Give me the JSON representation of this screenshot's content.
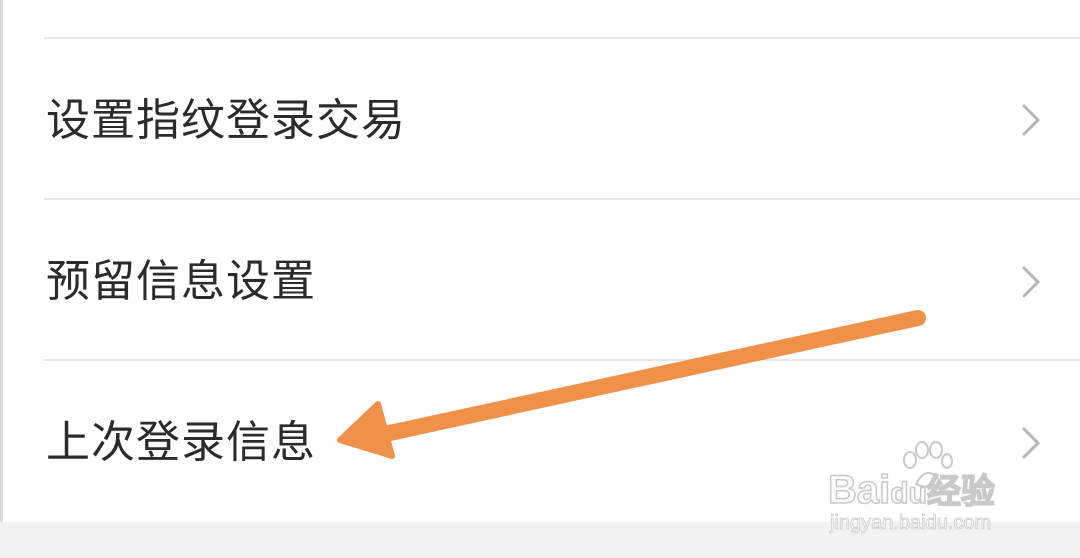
{
  "settings_list": {
    "items": [
      {
        "label": "设置指纹登录交易"
      },
      {
        "label": "预留信息设置"
      },
      {
        "label": "上次登录信息"
      }
    ]
  },
  "annotation": {
    "arrow_color": "#f0914a",
    "arrow_target": "上次登录信息"
  },
  "watermark": {
    "brand": "Bai",
    "brand_suffix": "du",
    "brand_cn": "经验",
    "url": "jingyan.baidu.com"
  },
  "colors": {
    "text": "#2b2b2b",
    "divider": "#e8e8e8",
    "chevron": "#b5b5b5",
    "footer": "#f2f2f2"
  }
}
